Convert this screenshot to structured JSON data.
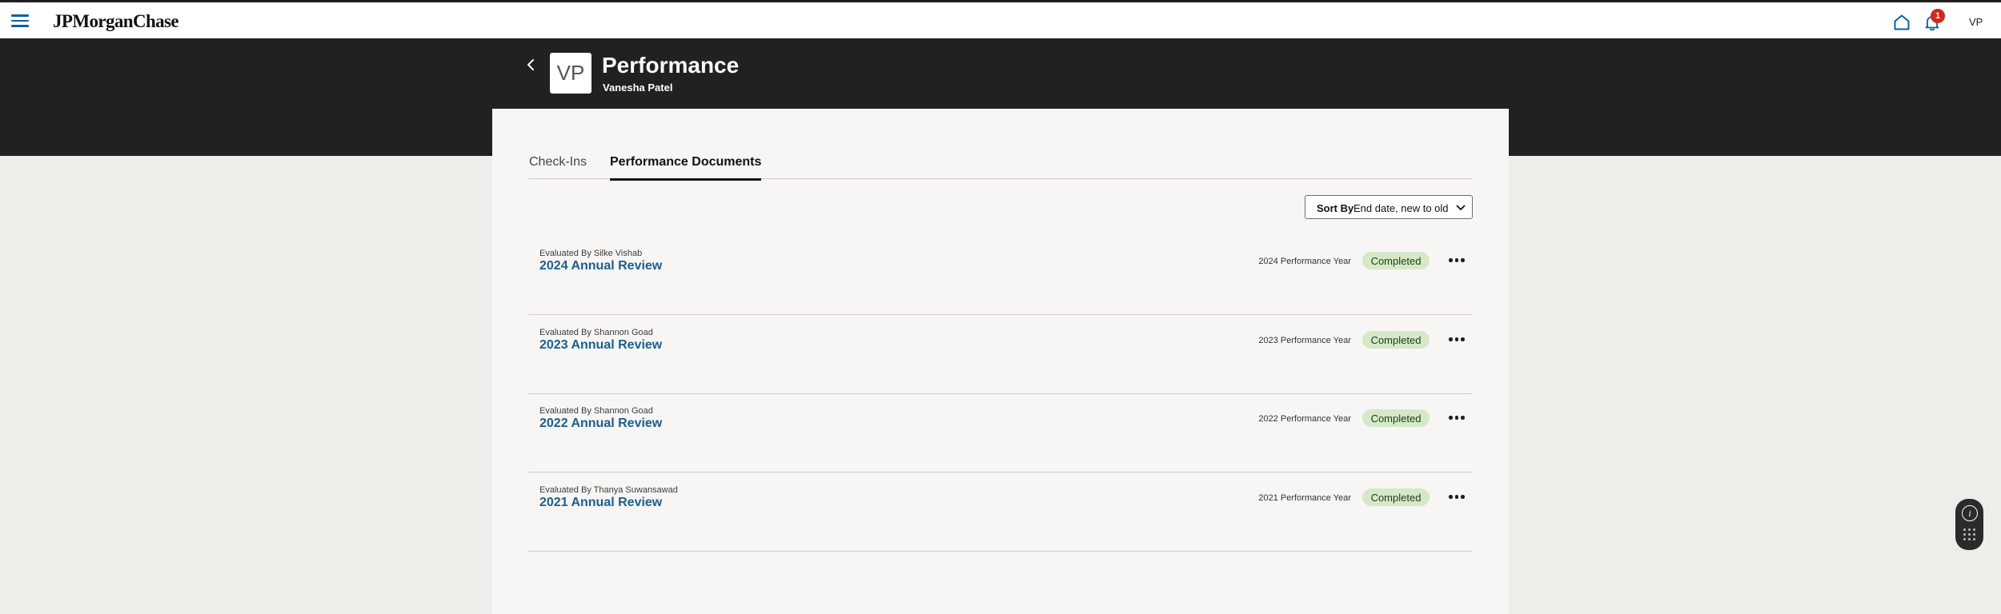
{
  "app": {
    "brand": "JPMorganChase",
    "notification_count": "1",
    "user_initials": "VP"
  },
  "header": {
    "title": "Performance",
    "employee_name": "Vanesha Patel",
    "avatar_initials": "VP"
  },
  "tabs": [
    {
      "label": "Check-Ins",
      "active": false
    },
    {
      "label": "Performance Documents",
      "active": true
    }
  ],
  "sort": {
    "label": "Sort By",
    "value": "End date, new to old"
  },
  "reviews": [
    {
      "evaluated_by": "Evaluated By Silke Vishab",
      "title": "2024 Annual Review",
      "year": "2024 Performance Year",
      "status": "Completed"
    },
    {
      "evaluated_by": "Evaluated By Shannon Goad",
      "title": "2023 Annual Review",
      "year": "2023 Performance Year",
      "status": "Completed"
    },
    {
      "evaluated_by": "Evaluated By Shannon Goad",
      "title": "2022 Annual Review",
      "year": "2022 Performance Year",
      "status": "Completed"
    },
    {
      "evaluated_by": "Evaluated By Thanya Suwansawad",
      "title": "2021 Annual Review",
      "year": "2021 Performance Year",
      "status": "Completed"
    }
  ],
  "icons": {
    "menu": "hamburger-icon",
    "home": "home-icon",
    "notifications": "bell-icon",
    "back": "chevron-left-icon",
    "sort": "chevron-down-icon",
    "row_actions": "more-horizontal-icon",
    "assistant": "info-icon"
  },
  "colors": {
    "accent": "#0b5fa8",
    "link": "#1a5e94",
    "header_band": "#212121",
    "status_completed_bg": "#d5e8c8",
    "badge": "#d4261d"
  }
}
